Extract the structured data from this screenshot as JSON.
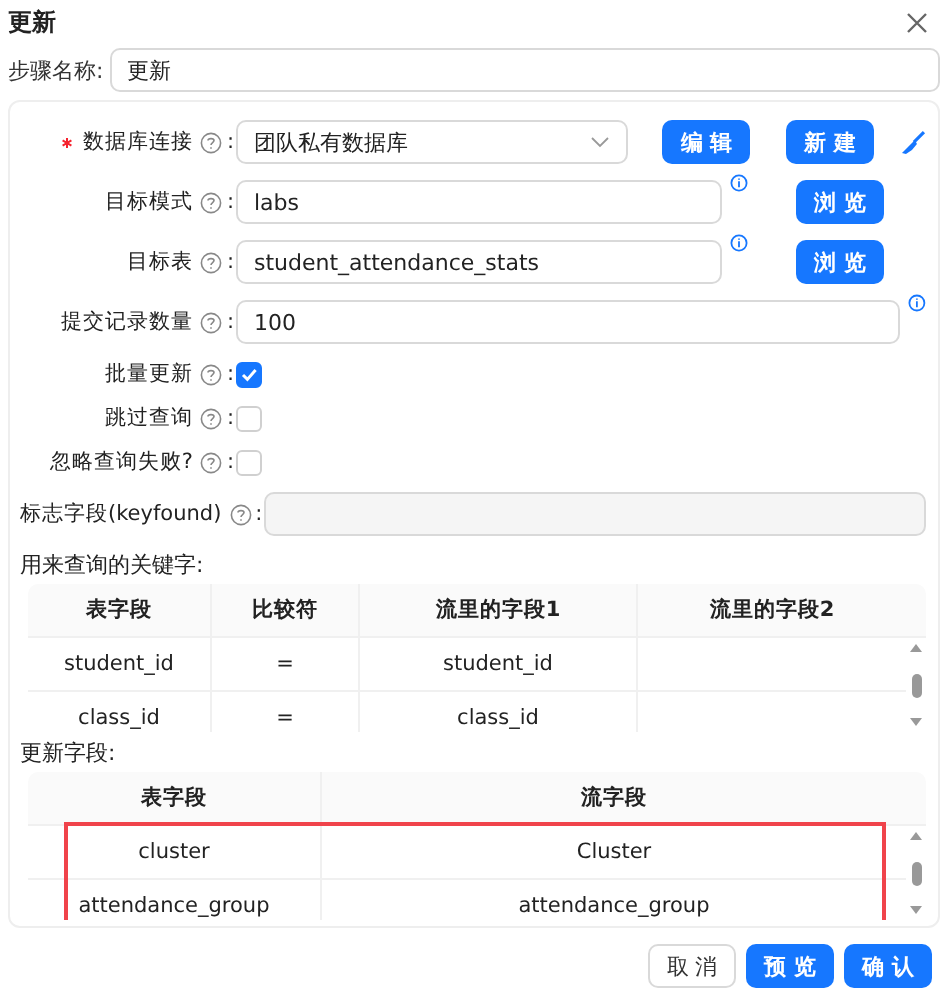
{
  "dialog": {
    "title": "更新"
  },
  "step_name": {
    "label": "步骤名称:",
    "value": "更新"
  },
  "form": [
    {
      "kind": "select",
      "label": "数据库连接",
      "colon": ":",
      "required": true,
      "help": true,
      "value": "团队私有数据库",
      "info": false,
      "buttons": [
        "编 辑",
        "新 建"
      ],
      "tool": true
    },
    {
      "kind": "text",
      "label": "目标模式",
      "colon": ":",
      "required": false,
      "help": true,
      "value": "labs",
      "info": true,
      "buttons": [
        "浏 览"
      ],
      "tool": false
    },
    {
      "kind": "text",
      "label": "目标表",
      "colon": ":",
      "required": false,
      "help": true,
      "value": "student_attendance_stats",
      "info": true,
      "buttons": [
        "浏 览"
      ],
      "tool": false
    },
    {
      "kind": "text",
      "label": "提交记录数量",
      "colon": ":",
      "required": false,
      "help": true,
      "value": "100",
      "info": true,
      "tool": false
    },
    {
      "kind": "checkbox",
      "label": "批量更新",
      "colon": ":",
      "required": false,
      "help": true,
      "checked": true
    },
    {
      "kind": "checkbox",
      "label": "跳过查询",
      "colon": ":",
      "required": false,
      "help": true,
      "checked": false
    },
    {
      "kind": "checkbox",
      "label": "忽略查询失败?",
      "colon": ":",
      "required": false,
      "help": true,
      "checked": false
    },
    {
      "kind": "disabled",
      "label": "标志字段(keyfound)",
      "colon": ":",
      "required": false,
      "help": true,
      "info": false,
      "tool": false
    }
  ],
  "key_table": {
    "label": "用来查询的关键字:",
    "columns": [
      "表字段",
      "比较符",
      "流里的字段1",
      "流里的字段2"
    ],
    "rows": [
      [
        "student_id",
        "=",
        "student_id"
      ],
      [
        "class_id",
        "=",
        "class_id"
      ]
    ],
    "highlighted": false
  },
  "update_table": {
    "label": "更新字段:",
    "columns": [
      "表字段",
      "流字段"
    ],
    "rows": [
      [
        "cluster",
        "Cluster"
      ],
      [
        "attendance_group",
        "attendance_group"
      ]
    ],
    "highlighted": true
  },
  "footer": [
    {
      "label": "取 消",
      "primary": false
    },
    {
      "label": "预 览",
      "primary": true
    },
    {
      "label": "确 认",
      "primary": true
    }
  ]
}
